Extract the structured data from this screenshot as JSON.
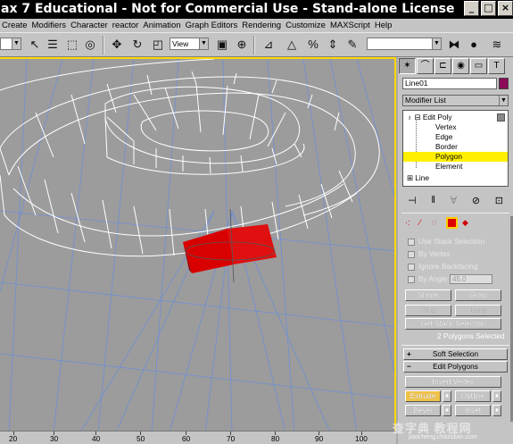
{
  "window": {
    "title": "ax 7  Educational - Not for Commercial Use - Stand-alone License",
    "buttons": [
      "_",
      "□",
      "×"
    ]
  },
  "menu": [
    "Create",
    "Modifiers",
    "Character",
    "reactor",
    "Animation",
    "Graph Editors",
    "Rendering",
    "Customize",
    "MAXScript",
    "Help"
  ],
  "toolbar": {
    "view_dropdown": "View",
    "named_selection": ""
  },
  "panel": {
    "tabs": [
      "create-icon",
      "modify-icon",
      "hierarchy-icon",
      "motion-icon",
      "display-icon",
      "utilities-icon"
    ],
    "object_name": "Line01",
    "object_color": "#8c0a5a",
    "modifier_list": "Modifier List",
    "stack": {
      "edit_poly": "Edit Poly",
      "sub_levels": [
        "Vertex",
        "Edge",
        "Border",
        "Polygon",
        "Element"
      ],
      "selected": "Polygon",
      "base": "Line"
    },
    "selection": {
      "use_stack": "Use Stack Selection",
      "by_vertex": "By Vertex",
      "ignore_backfacing": "Ignore Backfacing",
      "by_angle": "By Angle:",
      "angle_value": "45.0",
      "shrink": "Shrink",
      "grow": "Grow",
      "ring": "Ring",
      "loop": "Loop",
      "get_stack_selection": "Get Stack Selection",
      "status": "2 Polygons Selected"
    },
    "rollouts": {
      "soft_selection": "Soft Selection",
      "edit_polygons": "Edit Polygons"
    },
    "edit_polygons": {
      "insert_vertex": "Insert Vertex",
      "extrude": "Extrude",
      "outline": "Outline",
      "bevel": "Bevel",
      "inset": "Inset"
    }
  },
  "timeline": {
    "labels": [
      "20",
      "30",
      "40",
      "50",
      "60",
      "70",
      "80",
      "90",
      "100"
    ]
  },
  "watermark": {
    "main": "查字典 教程网",
    "url": "jiaocheng.chazidian.com"
  },
  "colors": {
    "selection_highlight": "#fff000",
    "selected_polygon": "#e00000",
    "active_viewport_border": "#ffd800"
  }
}
